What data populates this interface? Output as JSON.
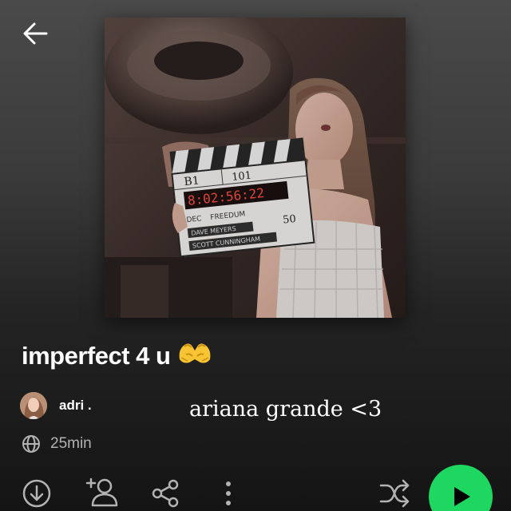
{
  "header": {
    "back_icon": "arrow-left-icon"
  },
  "playlist": {
    "cover_icon": "playlist-cover-image",
    "title": "imperfect 4 u",
    "title_emoji": "heart-hands-emoji",
    "owner": {
      "avatar_icon": "avatar-image",
      "name": "adri ."
    },
    "description": "ariana grande <3",
    "visibility_icon": "globe-icon",
    "duration": "25min"
  },
  "cover_art": {
    "clapper_scene": "B1",
    "clapper_take": "101",
    "clapper_timecode": "8:02:56:22",
    "clapper_date": "DEC",
    "clapper_title": "FREEDUM",
    "clapper_director": "DAVE MEYERS",
    "clapper_dp": "SCOTT CUNNINGHAM",
    "clapper_fps": "50"
  },
  "actions": {
    "download_icon": "download-icon",
    "add_follower_icon": "add-person-icon",
    "share_icon": "share-icon",
    "more_icon": "more-vertical-icon",
    "shuffle_icon": "shuffle-icon",
    "play_icon": "play-icon"
  },
  "colors": {
    "background_top": "#4a4a4a",
    "background_bottom": "#141414",
    "accent_green": "#1ed760",
    "secondary_text": "#b3b3b3"
  }
}
